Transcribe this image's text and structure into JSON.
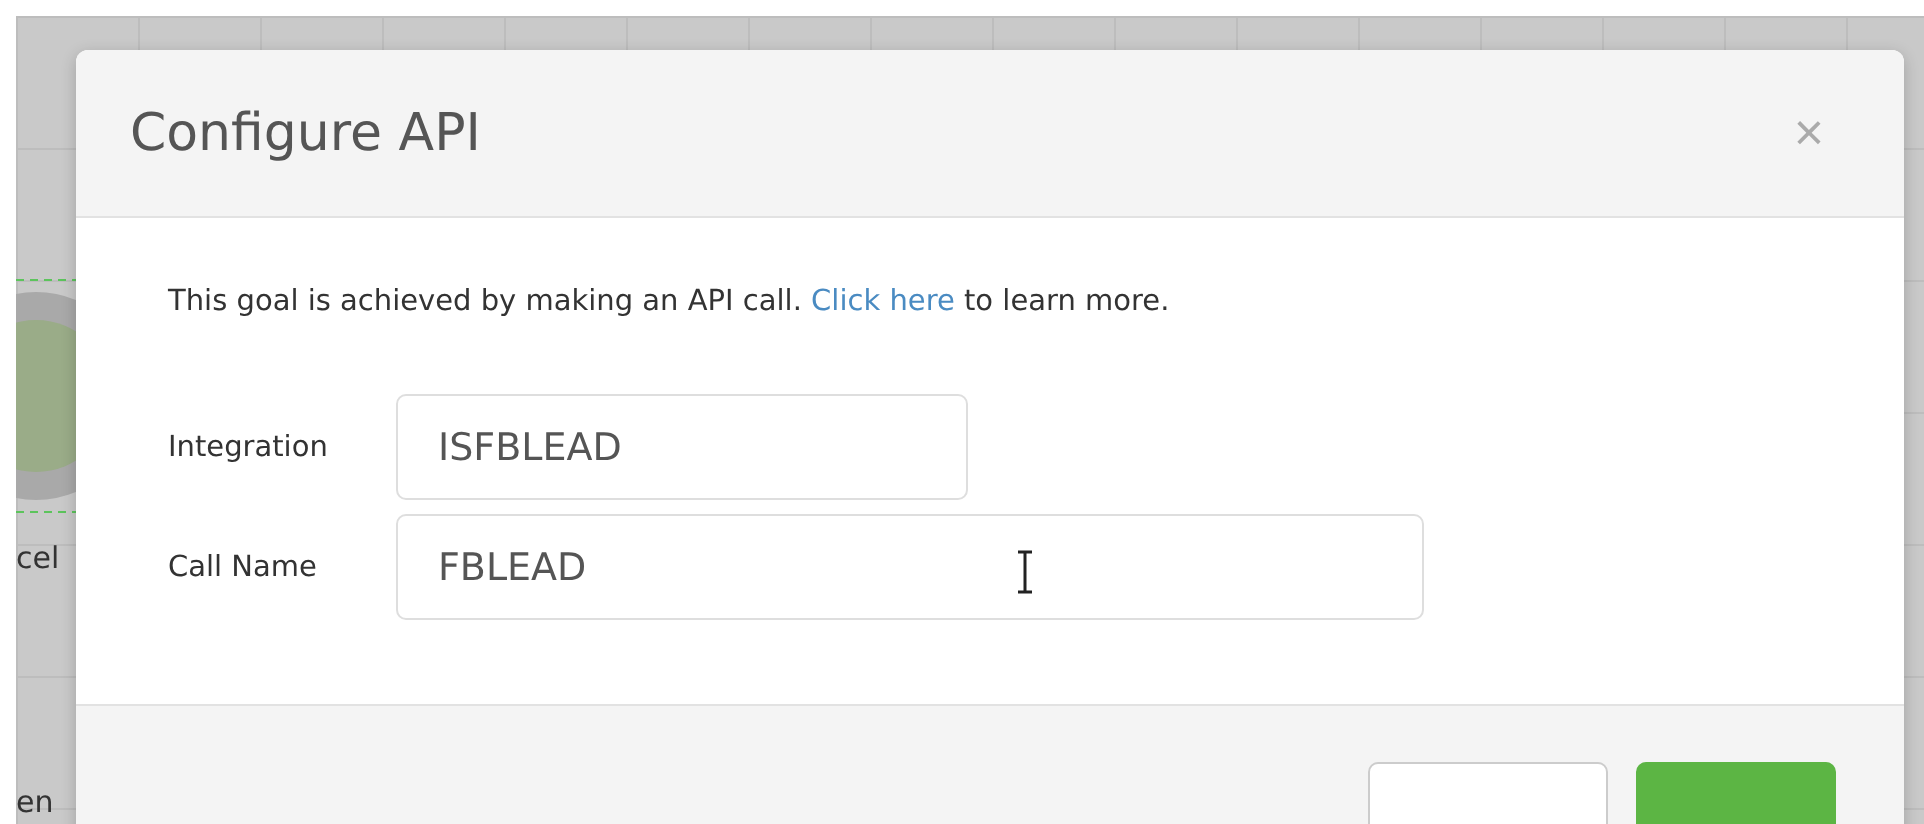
{
  "background": {
    "labels": [
      {
        "text": "cel"
      },
      {
        "text": "en"
      }
    ]
  },
  "dialog": {
    "title": "Configure API",
    "close": "×",
    "intro": {
      "before": "This goal is achieved by making an API call.",
      "link": "Click here",
      "after": "to learn more."
    },
    "fields": [
      {
        "label": "Integration",
        "value": "ISFBLEAD",
        "wide": false
      },
      {
        "label": "Call Name",
        "value": "FBLEAD",
        "wide": true
      }
    ],
    "buttons": [
      {
        "kind": "secondary"
      },
      {
        "kind": "primary"
      }
    ]
  }
}
